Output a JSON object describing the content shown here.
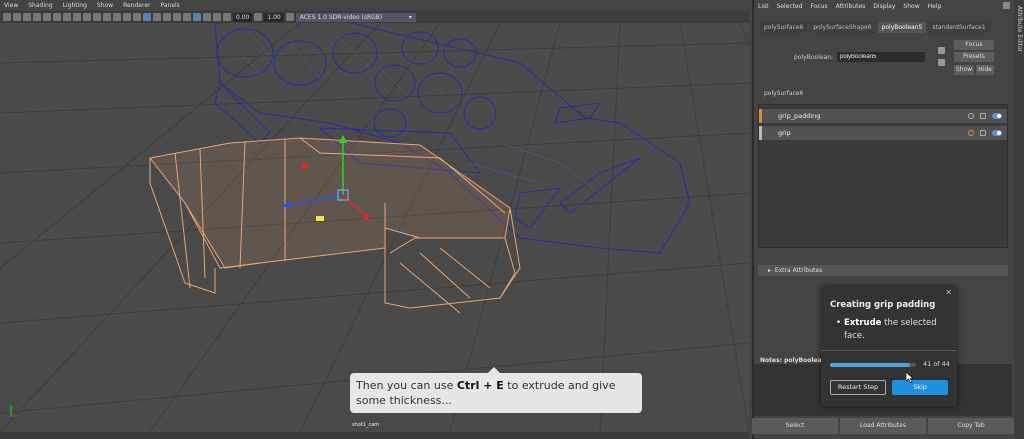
{
  "viewport": {
    "menu": [
      "View",
      "Shading",
      "Lighting",
      "Show",
      "Renderer",
      "Panels"
    ],
    "toolbar": {
      "exposure": "0.00",
      "gamma": "1.00",
      "color_space": "ACES 1.0 SDR-video (sRGB)"
    },
    "camera_label": "shot1_cam"
  },
  "hint": {
    "prefix": "Then you can use ",
    "shortcut": "Ctrl + E",
    "suffix": " to extrude and give some thickness..."
  },
  "attribute_editor": {
    "side_label": "Attribute Editor",
    "menu": [
      "List",
      "Selected",
      "Focus",
      "Attributes",
      "Display",
      "Show",
      "Help"
    ],
    "tabs": [
      "polySurface6",
      "polySurfaceShape6",
      "polyBoolean5",
      "standardSurface1"
    ],
    "active_tab": "polyBoolean5",
    "field_label": "polyBoolean:",
    "field_value": "polyBoolean5",
    "buttons": {
      "focus": "Focus",
      "presets": "Presets",
      "show": "Show",
      "hide": "Hide"
    },
    "section_title": "polySurface6",
    "layers": [
      {
        "name": "grip_padding",
        "color": "#d98c3a"
      },
      {
        "name": "grip",
        "color": "#bbbbbb"
      }
    ],
    "extra_attributes": "Extra Attributes",
    "notes_label": "Notes:  polyBoolean",
    "bottom_buttons": [
      "Select",
      "Load Attributes",
      "Copy Tab"
    ]
  },
  "tutorial": {
    "title": "Creating grip padding",
    "step_bold": "Extrude",
    "step_rest": " the selected face.",
    "progress_fraction": 0.93,
    "progress_text": "41 of 44",
    "restart_label": "Restart Step",
    "skip_label": "Skip"
  }
}
